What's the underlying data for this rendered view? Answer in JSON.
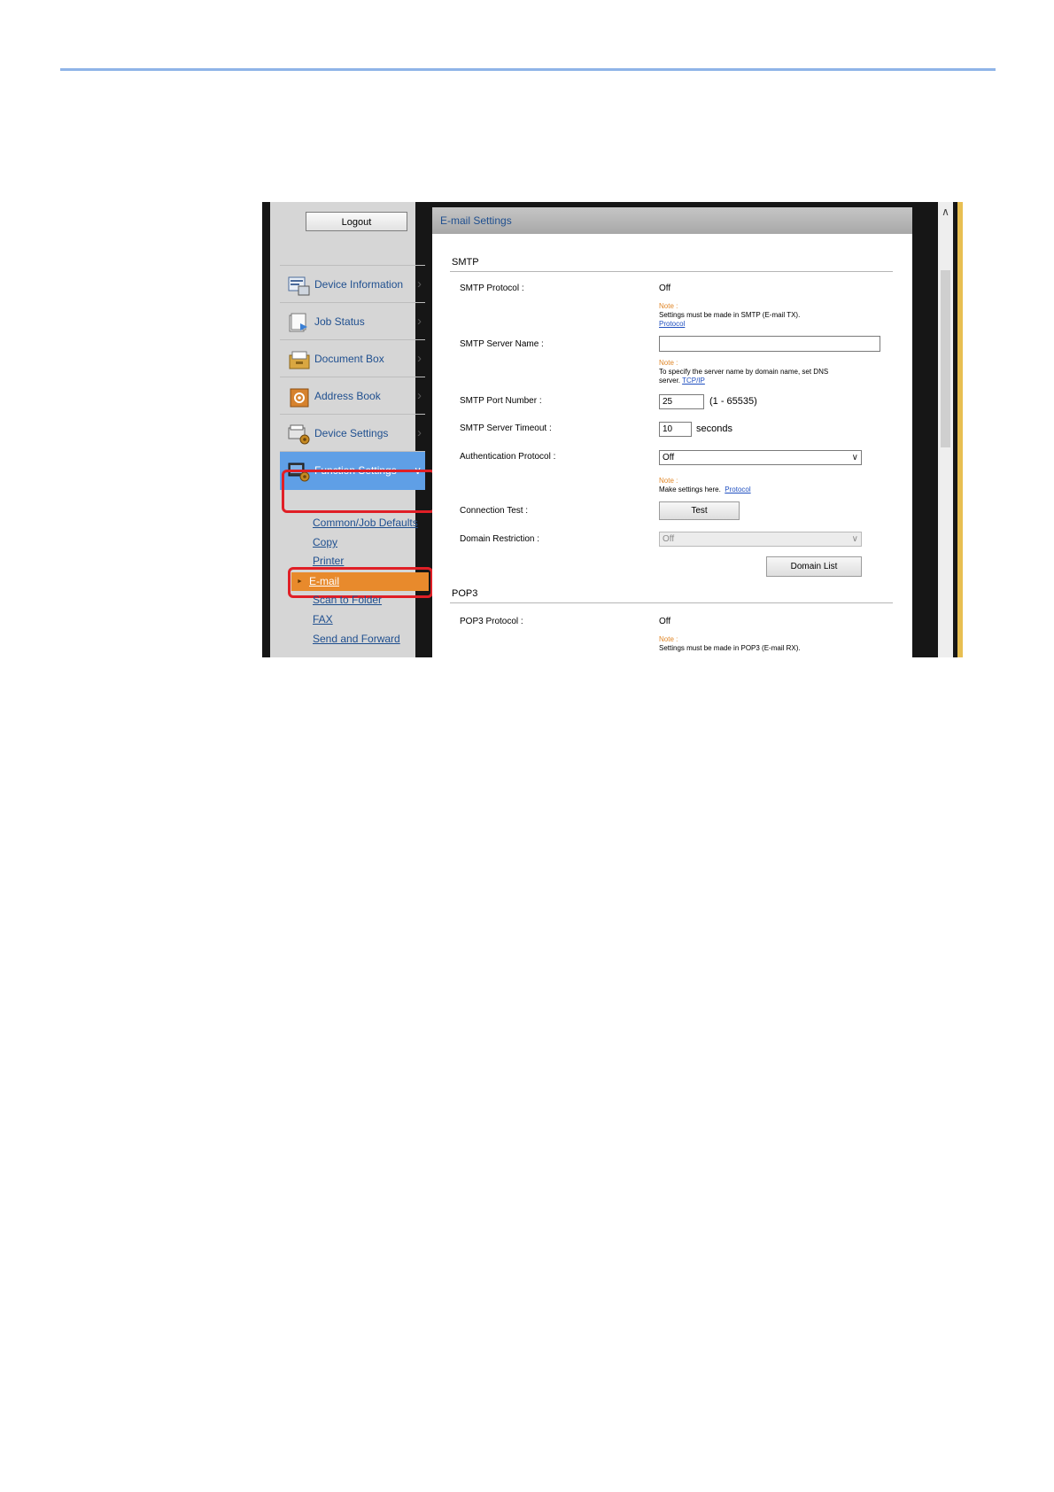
{
  "sidebar": {
    "logout_label": "Logout",
    "items": [
      {
        "label": "Device Information",
        "icon": "device-information-icon"
      },
      {
        "label": "Job Status",
        "icon": "job-status-icon"
      },
      {
        "label": "Document Box",
        "icon": "document-box-icon"
      },
      {
        "label": "Address Book",
        "icon": "address-book-icon"
      },
      {
        "label": "Device Settings",
        "icon": "device-settings-icon"
      },
      {
        "label": "Function Settings",
        "icon": "function-settings-icon",
        "expanded": true
      }
    ],
    "sub_items": [
      {
        "label": "Common/Job Defaults"
      },
      {
        "label": "Copy"
      },
      {
        "label": "Printer"
      },
      {
        "label": "E-mail",
        "active": true
      },
      {
        "label": "Scan to Folder"
      },
      {
        "label": "FAX"
      },
      {
        "label": "Send and Forward"
      }
    ]
  },
  "panel": {
    "title": "E-mail Settings",
    "smtp": {
      "section_title": "SMTP",
      "protocol_label": "SMTP Protocol :",
      "protocol_value": "Off",
      "protocol_note_label": "Note :",
      "protocol_note_text": "Settings must be made in SMTP (E-mail TX).",
      "protocol_note_link": "Protocol",
      "server_name_label": "SMTP Server Name :",
      "server_name_value": "",
      "server_name_note_label": "Note :",
      "server_name_note_text_1": "To specify the server name by domain name, set DNS",
      "server_name_note_text_2": "server.",
      "server_name_note_link": "TCP/IP",
      "port_label": "SMTP Port Number :",
      "port_value": "25",
      "port_range": "(1 - 65535)",
      "timeout_label": "SMTP Server Timeout :",
      "timeout_value": "10",
      "timeout_unit": "seconds",
      "auth_label": "Authentication Protocol :",
      "auth_value": "Off",
      "auth_note_label": "Note :",
      "auth_note_text": "Make settings here.",
      "auth_note_link": "Protocol",
      "connection_test_label": "Connection Test :",
      "test_button": "Test",
      "domain_restriction_label": "Domain Restriction :",
      "domain_restriction_value": "Off",
      "domain_list_button": "Domain List"
    },
    "pop3": {
      "section_title": "POP3",
      "protocol_label": "POP3 Protocol :",
      "protocol_value": "Off",
      "protocol_note_label": "Note :",
      "protocol_note_text": "Settings must be made in POP3 (E-mail RX)."
    }
  },
  "colors": {
    "highlight_box": "#e01f26",
    "active_item": "#5f9fe6",
    "active_sub_item": "#e88a2c",
    "note": "#e0882a",
    "link": "#1f4f8f"
  }
}
